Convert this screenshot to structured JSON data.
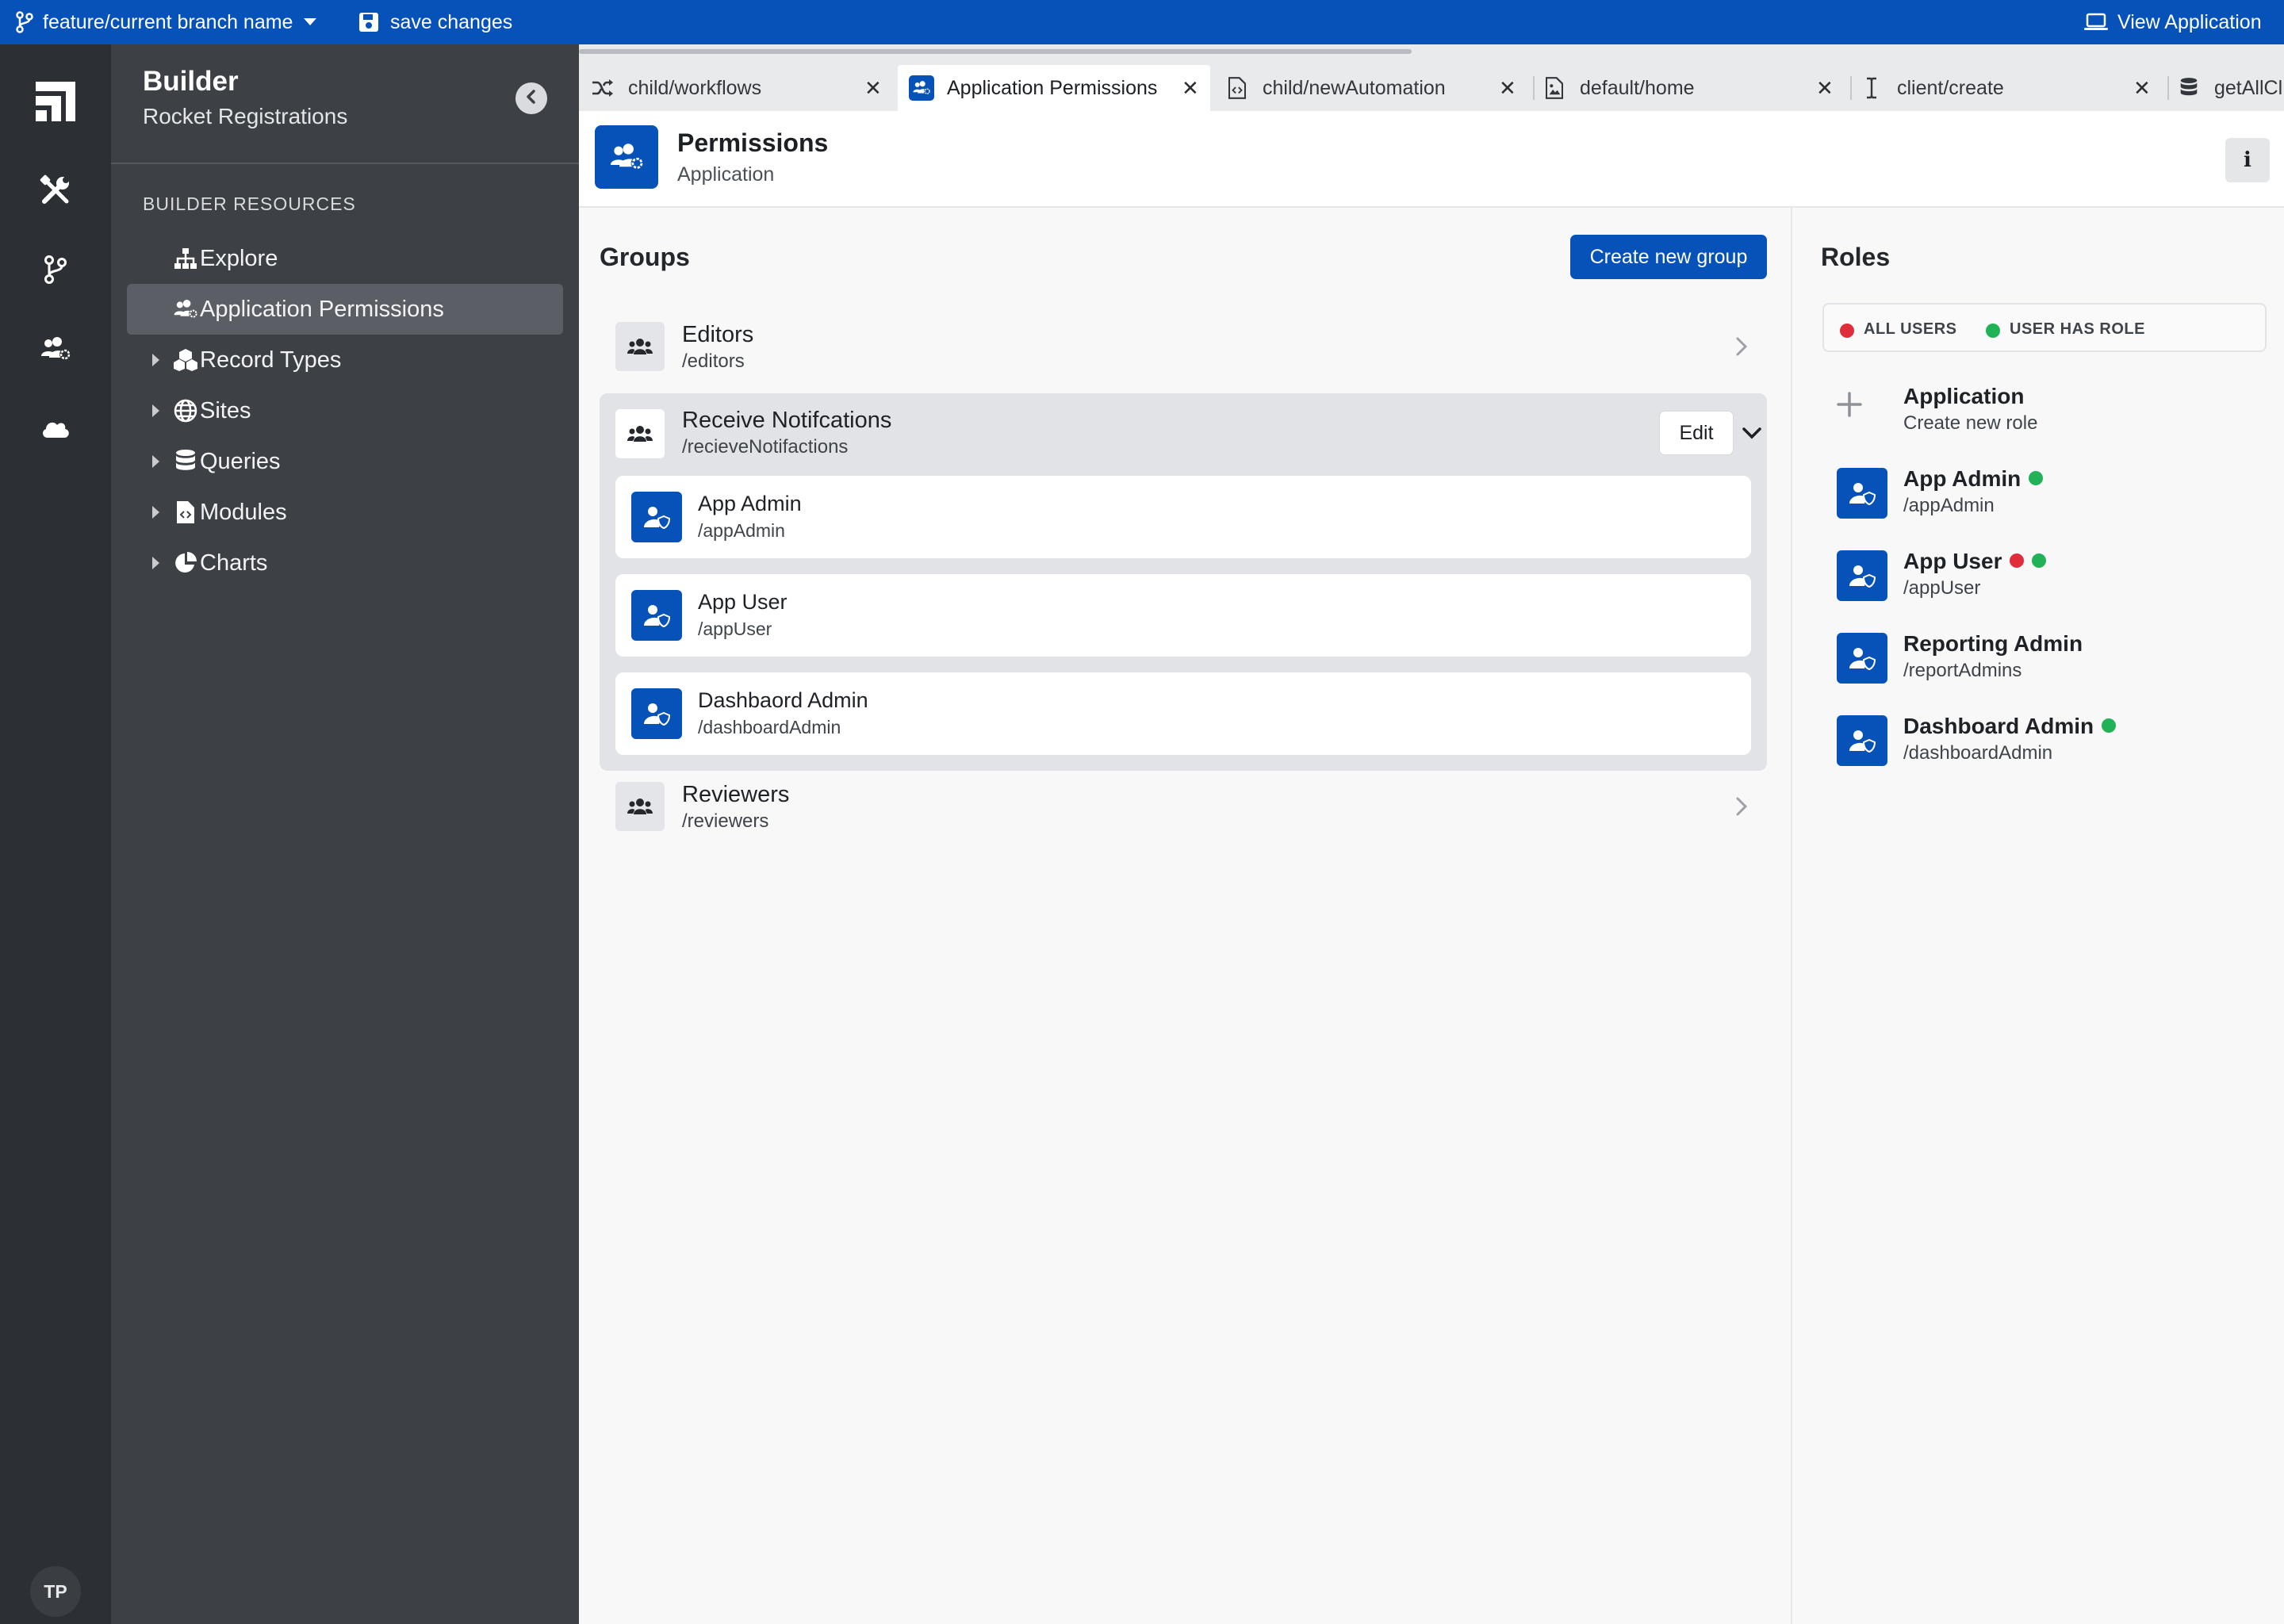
{
  "topbar": {
    "branch_name": "feature/current branch name",
    "save_label": "save changes",
    "view_app_label": "View Application"
  },
  "rail": {
    "icons": [
      "app-logo-icon",
      "tools-icon",
      "git-branch-icon",
      "users-gear-icon",
      "cloud-icon"
    ],
    "avatar_initials": "TP"
  },
  "sidebar": {
    "title": "Builder",
    "subtitle": "Rocket Registrations",
    "section_label": "BUILDER RESOURCES",
    "items": [
      {
        "label": "Explore",
        "icon": "sitemap-icon",
        "expandable": false,
        "active": false
      },
      {
        "label": "Application Permissions",
        "icon": "users-gear-icon",
        "expandable": false,
        "active": true
      },
      {
        "label": "Record Types",
        "icon": "cubes-icon",
        "expandable": true,
        "active": false
      },
      {
        "label": "Sites",
        "icon": "globe-icon",
        "expandable": true,
        "active": false
      },
      {
        "label": "Queries",
        "icon": "database-icon",
        "expandable": true,
        "active": false
      },
      {
        "label": "Modules",
        "icon": "file-code-icon",
        "expandable": true,
        "active": false
      },
      {
        "label": "Charts",
        "icon": "pie-chart-icon",
        "expandable": true,
        "active": false
      }
    ]
  },
  "tabs": [
    {
      "label": "child/workflows",
      "icon": "shuffle-icon",
      "active": false
    },
    {
      "label": "Application Permissions",
      "icon": "users-gear-icon",
      "active": true
    },
    {
      "label": "child/newAutomation",
      "icon": "file-code-icon",
      "active": false
    },
    {
      "label": "default/home",
      "icon": "file-image-icon",
      "active": false
    },
    {
      "label": "client/create",
      "icon": "text-cursor-icon",
      "active": false
    },
    {
      "label": "getAllCl",
      "icon": "database-icon",
      "active": false
    }
  ],
  "page": {
    "title": "Permissions",
    "subtitle": "Application",
    "info_label": "i"
  },
  "groups": {
    "title": "Groups",
    "create_label": "Create new group",
    "edit_label": "Edit",
    "items": [
      {
        "name": "Editors",
        "path": "/editors",
        "expanded": false
      },
      {
        "name": "Receive Notifcations",
        "path": "/recieveNotifactions",
        "expanded": true,
        "roles": [
          {
            "name": "App Admin",
            "path": "/appAdmin"
          },
          {
            "name": "App User",
            "path": "/appUser"
          },
          {
            "name": "Dashbaord Admin",
            "path": "/dashboardAdmin"
          }
        ]
      },
      {
        "name": "Reviewers",
        "path": "/reviewers",
        "expanded": false
      }
    ]
  },
  "roles": {
    "title": "Roles",
    "legend": [
      {
        "label": "ALL USERS",
        "color": "#e02d3c"
      },
      {
        "label": "USER HAS ROLE",
        "color": "#21b157"
      }
    ],
    "new_role": {
      "title": "Application",
      "subtitle": "Create new role"
    },
    "items": [
      {
        "name": "App Admin",
        "path": "/appAdmin",
        "dots": [
          "#21b157"
        ]
      },
      {
        "name": "App User",
        "path": "/appUser",
        "dots": [
          "#e02d3c",
          "#21b157"
        ]
      },
      {
        "name": "Reporting Admin",
        "path": "/reportAdmins",
        "dots": []
      },
      {
        "name": "Dashboard Admin",
        "path": "/dashboardAdmin",
        "dots": [
          "#21b157"
        ]
      }
    ]
  },
  "colors": {
    "brand": "#0652b8",
    "sidebar": "#3d4146",
    "rail": "#2c2f33"
  }
}
